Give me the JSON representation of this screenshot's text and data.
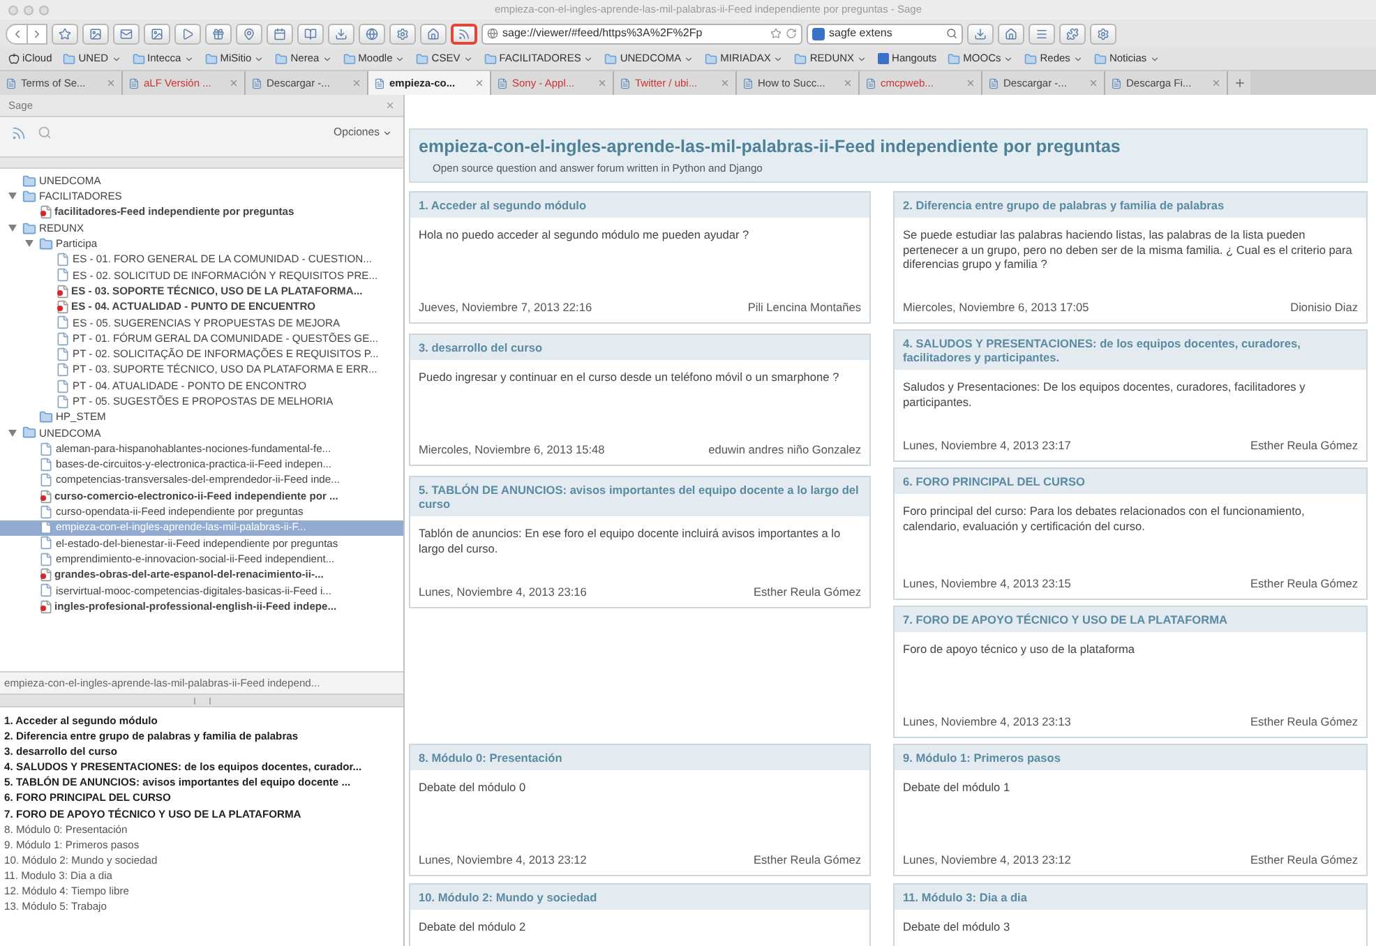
{
  "window": {
    "title": "empieza-con-el-ingles-aprende-las-mil-palabras-ii-Feed independiente por preguntas - Sage"
  },
  "toolbar": {
    "address": "sage://viewer/#feed/https%3A%2F%2Fp",
    "search": "sagfe extens"
  },
  "bookmarks": [
    {
      "label": "iCloud",
      "kind": "apple"
    },
    {
      "label": "UNED",
      "kind": "folder"
    },
    {
      "label": "Intecca",
      "kind": "folder"
    },
    {
      "label": "MiSitio",
      "kind": "folder"
    },
    {
      "label": "Nerea",
      "kind": "folder"
    },
    {
      "label": "Moodle",
      "kind": "folder"
    },
    {
      "label": "CSEV",
      "kind": "folder"
    },
    {
      "label": "FACILITADORES",
      "kind": "folder"
    },
    {
      "label": "UNEDCOMA",
      "kind": "folder"
    },
    {
      "label": "MIRIADAX",
      "kind": "folder"
    },
    {
      "label": "REDUNX",
      "kind": "folder"
    },
    {
      "label": "Hangouts",
      "kind": "link"
    },
    {
      "label": "MOOCs",
      "kind": "folder"
    },
    {
      "label": "Redes",
      "kind": "folder"
    },
    {
      "label": "Noticias",
      "kind": "folder"
    }
  ],
  "tabs": [
    {
      "label": "Terms of Se...",
      "selected": false,
      "color": "#444444"
    },
    {
      "label": "aLF Versión ...",
      "selected": false,
      "color": "#cc3333"
    },
    {
      "label": "Descargar -...",
      "selected": false,
      "color": "#444444"
    },
    {
      "label": "empieza-co...",
      "selected": true,
      "color": "#222222"
    },
    {
      "label": "Sony - Appl...",
      "selected": false,
      "color": "#cc3333"
    },
    {
      "label": "Twitter / ubi...",
      "selected": false,
      "color": "#cc3333"
    },
    {
      "label": "How to Succ...",
      "selected": false,
      "color": "#444444"
    },
    {
      "label": "cmcpweb...",
      "selected": false,
      "color": "#cc3333"
    },
    {
      "label": "Descargar -...",
      "selected": false,
      "color": "#444444"
    },
    {
      "label": "Descarga Fi...",
      "selected": false,
      "color": "#444444"
    }
  ],
  "sidebar": {
    "title": "Sage",
    "options": "Opciones",
    "tree": [
      {
        "kind": "folder",
        "label": "UNEDCOMA",
        "selected": false
      },
      {
        "kind": "folder",
        "label": "FACILITADORES",
        "selected": false,
        "expanded": true,
        "children": [
          {
            "kind": "feed",
            "label": "facilitadores-Feed independiente por preguntas",
            "unread": true,
            "selected": false
          }
        ]
      },
      {
        "kind": "folder",
        "label": "REDUNX",
        "selected": false,
        "expanded": true,
        "children": [
          {
            "kind": "folder",
            "label": "Participa",
            "selected": false,
            "expanded": true,
            "children": [
              {
                "kind": "feed",
                "label": "ES - 01. FORO GENERAL DE LA COMUNIDAD - CUESTION...",
                "unread": false,
                "selected": false
              },
              {
                "kind": "feed",
                "label": "ES - 02. SOLICITUD DE INFORMACIÓN Y REQUISITOS PRE...",
                "unread": false,
                "selected": false
              },
              {
                "kind": "feed",
                "label": "ES - 03. SOPORTE TÉCNICO, USO DE LA PLATAFORMA...",
                "unread": true,
                "selected": false
              },
              {
                "kind": "feed",
                "label": "ES - 04. ACTUALIDAD - PUNTO DE ENCUENTRO",
                "unread": true,
                "selected": false
              },
              {
                "kind": "feed",
                "label": "ES - 05. SUGERENCIAS Y PROPUESTAS DE MEJORA",
                "unread": false,
                "selected": false
              },
              {
                "kind": "feed",
                "label": "PT - 01. FÓRUM GERAL DA COMUNIDADE - QUESTÕES GE...",
                "unread": false,
                "selected": false
              },
              {
                "kind": "feed",
                "label": "PT - 02. SOLICITAÇÃO DE INFORMAÇÕES E REQUISITOS P...",
                "unread": false,
                "selected": false
              },
              {
                "kind": "feed",
                "label": "PT - 03. SUPORTE TÉCNICO, USO DA PLATAFORMA E ERR...",
                "unread": false,
                "selected": false
              },
              {
                "kind": "feed",
                "label": "PT - 04. ATUALIDADE - PONTO DE ENCONTRO",
                "unread": false,
                "selected": false
              },
              {
                "kind": "feed",
                "label": "PT - 05. SUGESTÕES E PROPOSTAS DE MELHORIA",
                "unread": false,
                "selected": false
              }
            ]
          },
          {
            "kind": "folder",
            "label": "HP_STEM",
            "selected": false
          }
        ]
      },
      {
        "kind": "folder",
        "label": "UNEDCOMA",
        "selected": false,
        "expanded": true,
        "children": [
          {
            "kind": "feed",
            "label": "aleman-para-hispanohablantes-nociones-fundamental-fe...",
            "unread": false,
            "selected": false
          },
          {
            "kind": "feed",
            "label": "bases-de-circuitos-y-electronica-practica-ii-Feed indepen...",
            "unread": false,
            "selected": false
          },
          {
            "kind": "feed",
            "label": "competencias-transversales-del-emprendedor-ii-Feed inde...",
            "unread": false,
            "selected": false
          },
          {
            "kind": "feed",
            "label": "curso-comercio-electronico-ii-Feed independiente por ...",
            "unread": true,
            "selected": false
          },
          {
            "kind": "feed",
            "label": "curso-opendata-ii-Feed independiente por preguntas",
            "unread": false,
            "selected": false
          },
          {
            "kind": "feed",
            "label": "empieza-con-el-ingles-aprende-las-mil-palabras-ii-F...",
            "unread": false,
            "selected": true
          },
          {
            "kind": "feed",
            "label": "el-estado-del-bienestar-ii-Feed independiente por preguntas",
            "unread": false,
            "selected": false
          },
          {
            "kind": "feed",
            "label": "emprendimiento-e-innovacion-social-ii-Feed independient...",
            "unread": false,
            "selected": false
          },
          {
            "kind": "feed",
            "label": "grandes-obras-del-arte-espanol-del-renacimiento-ii-...",
            "unread": true,
            "selected": false
          },
          {
            "kind": "feed",
            "label": "iservirtual-mooc-competencias-digitales-basicas-ii-Feed i...",
            "unread": false,
            "selected": false
          },
          {
            "kind": "feed",
            "label": "ingles-profesional-professional-english-ii-Feed indepe...",
            "unread": true,
            "selected": false
          }
        ]
      }
    ],
    "status": "empieza-con-el-ingles-aprende-las-mil-palabras-ii-Feed independ...",
    "items": [
      {
        "label": "1. Acceder al segundo módulo",
        "unread": true,
        "selected": false
      },
      {
        "label": "2. Diferencia entre grupo de palabras y familia de palabras",
        "unread": true,
        "selected": false
      },
      {
        "label": "3. desarrollo del curso",
        "unread": true,
        "selected": false
      },
      {
        "label": "4. SALUDOS Y PRESENTACIONES: de los equipos docentes, curador...",
        "unread": true,
        "selected": false
      },
      {
        "label": "5. TABLÓN DE ANUNCIOS: avisos importantes del equipo docente ...",
        "unread": true,
        "selected": false
      },
      {
        "label": "6. FORO PRINCIPAL DEL CURSO",
        "unread": true,
        "selected": false
      },
      {
        "label": "7. FORO DE APOYO TÉCNICO Y USO DE LA PLATAFORMA",
        "unread": true,
        "selected": false
      },
      {
        "label": "8. Módulo 0: Presentación",
        "unread": false,
        "selected": false
      },
      {
        "label": "9. Módulo 1: Primeros pasos",
        "unread": false,
        "selected": false
      },
      {
        "label": "10. Módulo 2: Mundo y sociedad",
        "unread": false,
        "selected": false
      },
      {
        "label": "11. Modulo 3: Dia a dia",
        "unread": false,
        "selected": false
      },
      {
        "label": "12. Módulo 4: Tiempo libre",
        "unread": false,
        "selected": false
      },
      {
        "label": "13. Módulo 5: Trabajo",
        "unread": false,
        "selected": false
      }
    ]
  },
  "feed": {
    "title": "empieza-con-el-ingles-aprende-las-mil-palabras-ii-Feed independiente por preguntas",
    "subtitle": "Open source question and answer forum written in Python and Django",
    "left_cards": [
      {
        "title": "1.  Acceder al segundo módulo",
        "body": "Hola no puedo acceder al segundo módulo me pueden ayudar ?",
        "date": "Jueves, Noviembre 7, 2013 22:16",
        "author": "Pili Lencina Montañes"
      },
      {
        "title": "3.  desarrollo del curso",
        "body": "Puedo ingresar y continuar en el curso desde un teléfono móvil o un smarphone ?",
        "date": "Miercoles, Noviembre 6, 2013 15:48",
        "author": "eduwin andres niño Gonzalez"
      },
      {
        "title": "5.  TABLÓN DE ANUNCIOS: avisos importantes del equipo docente a lo largo del curso",
        "body": "Tablón de anuncios: En ese foro el equipo docente incluirá avisos importantes a lo largo del curso.",
        "date": "Lunes, Noviembre 4, 2013 23:16",
        "author": "Esther Reula Gómez"
      }
    ],
    "right_cards": [
      {
        "title": "2.  Diferencia entre grupo de palabras y familia de palabras",
        "body": "Se puede estudiar las palabras haciendo listas, las palabras de la lista pueden pertenecer a un grupo, pero no deben ser de la misma familia. ¿ Cual es el criterio para diferencias grupo y familia ?",
        "date": "Miercoles, Noviembre 6, 2013 17:05",
        "author": "Dionisio Diaz"
      },
      {
        "title": "4.  SALUDOS Y PRESENTACIONES: de los equipos docentes, curadores, facilitadores y participantes.",
        "body": "Saludos y Presentaciones: De los equipos docentes, curadores, facilitadores y participantes.",
        "date": "Lunes, Noviembre 4, 2013 23:17",
        "author": "Esther Reula Gómez"
      },
      {
        "title": "6.  FORO PRINCIPAL DEL CURSO",
        "body": "Foro principal del curso: Para los debates relacionados con el funcionamiento, calendario, evaluación y certificación del curso.",
        "date": "Lunes, Noviembre 4, 2013 23:15",
        "author": "Esther Reula Gómez"
      },
      {
        "title": "7.  FORO DE APOYO TÉCNICO Y USO DE LA PLATAFORMA",
        "body": "Foro de apoyo técnico y uso de la plataforma",
        "date": "Lunes, Noviembre 4, 2013 23:13",
        "author": "Esther Reula Gómez"
      }
    ],
    "lower_cards": [
      {
        "title": "8.  Módulo 0: Presentación",
        "body": "Debate del módulo 0",
        "date": "Lunes, Noviembre 4, 2013 23:12",
        "author": "Esther Reula Gómez"
      },
      {
        "title": "9.  Módulo 1: Primeros pasos",
        "body": "Debate del módulo 1",
        "date": "Lunes, Noviembre 4, 2013 23:12",
        "author": "Esther Reula Gómez"
      },
      {
        "title": "10.  Módulo 2: Mundo y sociedad",
        "body": "Debate del módulo 2"
      },
      {
        "title": "11.  Módulo 3: Dia a dia",
        "body": "Debate del módulo 3"
      }
    ]
  }
}
